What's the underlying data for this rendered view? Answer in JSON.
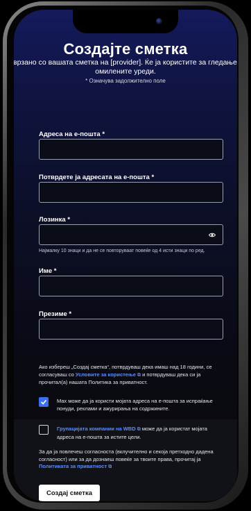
{
  "header": {
    "title": "Создајте сметка",
    "subtitle": "Поврзано со вашата сметка на [provider]. Ќе ја користите за гледање на омилените уреди.",
    "required_note": "* Означува задолжително поле"
  },
  "form": {
    "email_label": "Адреса на е-пошта *",
    "confirm_email_label": "Потврдете ја адресата на е-пошта *",
    "password_label": "Лозинка *",
    "password_hint": "Најмалку 10 знаци и да не се повторуваат повеќе од 4 исти знаци по ред.",
    "first_name_label": "Име *",
    "last_name_label": "Презиме *"
  },
  "legal": {
    "text_before": "Ако избереш „Создај сметка“, потврдуваш дека имаш над 18 години, се согласуваш со ",
    "terms_link": "Условите за користење",
    "text_middle": " и потврдуваш дека си ја прочитал(а) нашата Политика за приватност."
  },
  "consent": {
    "max_checked": true,
    "max_text": "Max може да ја користи мојата адреса на е-пошта за испраќање понуди, реклами и ажурирања на содржините.",
    "wbd_checked": false,
    "wbd_link": "Групацијата компании на WBD",
    "wbd_text": " може да ја користат мојата адреса на е-пошта за истите цели."
  },
  "withdraw": {
    "text_before": "За да ја повлечеш согласноста (вклучително и секоја претходно дадена согласност) или за да дознаеш повеќе за твоите права, прочитај ја ",
    "privacy_link": "Политиката за приватност"
  },
  "submit_label": "Создај сметка",
  "icons": {
    "external": "external-link-icon",
    "eye": "eye-icon",
    "check": "checkmark-icon"
  },
  "colors": {
    "accent": "#3b6ff0",
    "link": "#5b8cff",
    "header_bg": "#141a5c"
  }
}
